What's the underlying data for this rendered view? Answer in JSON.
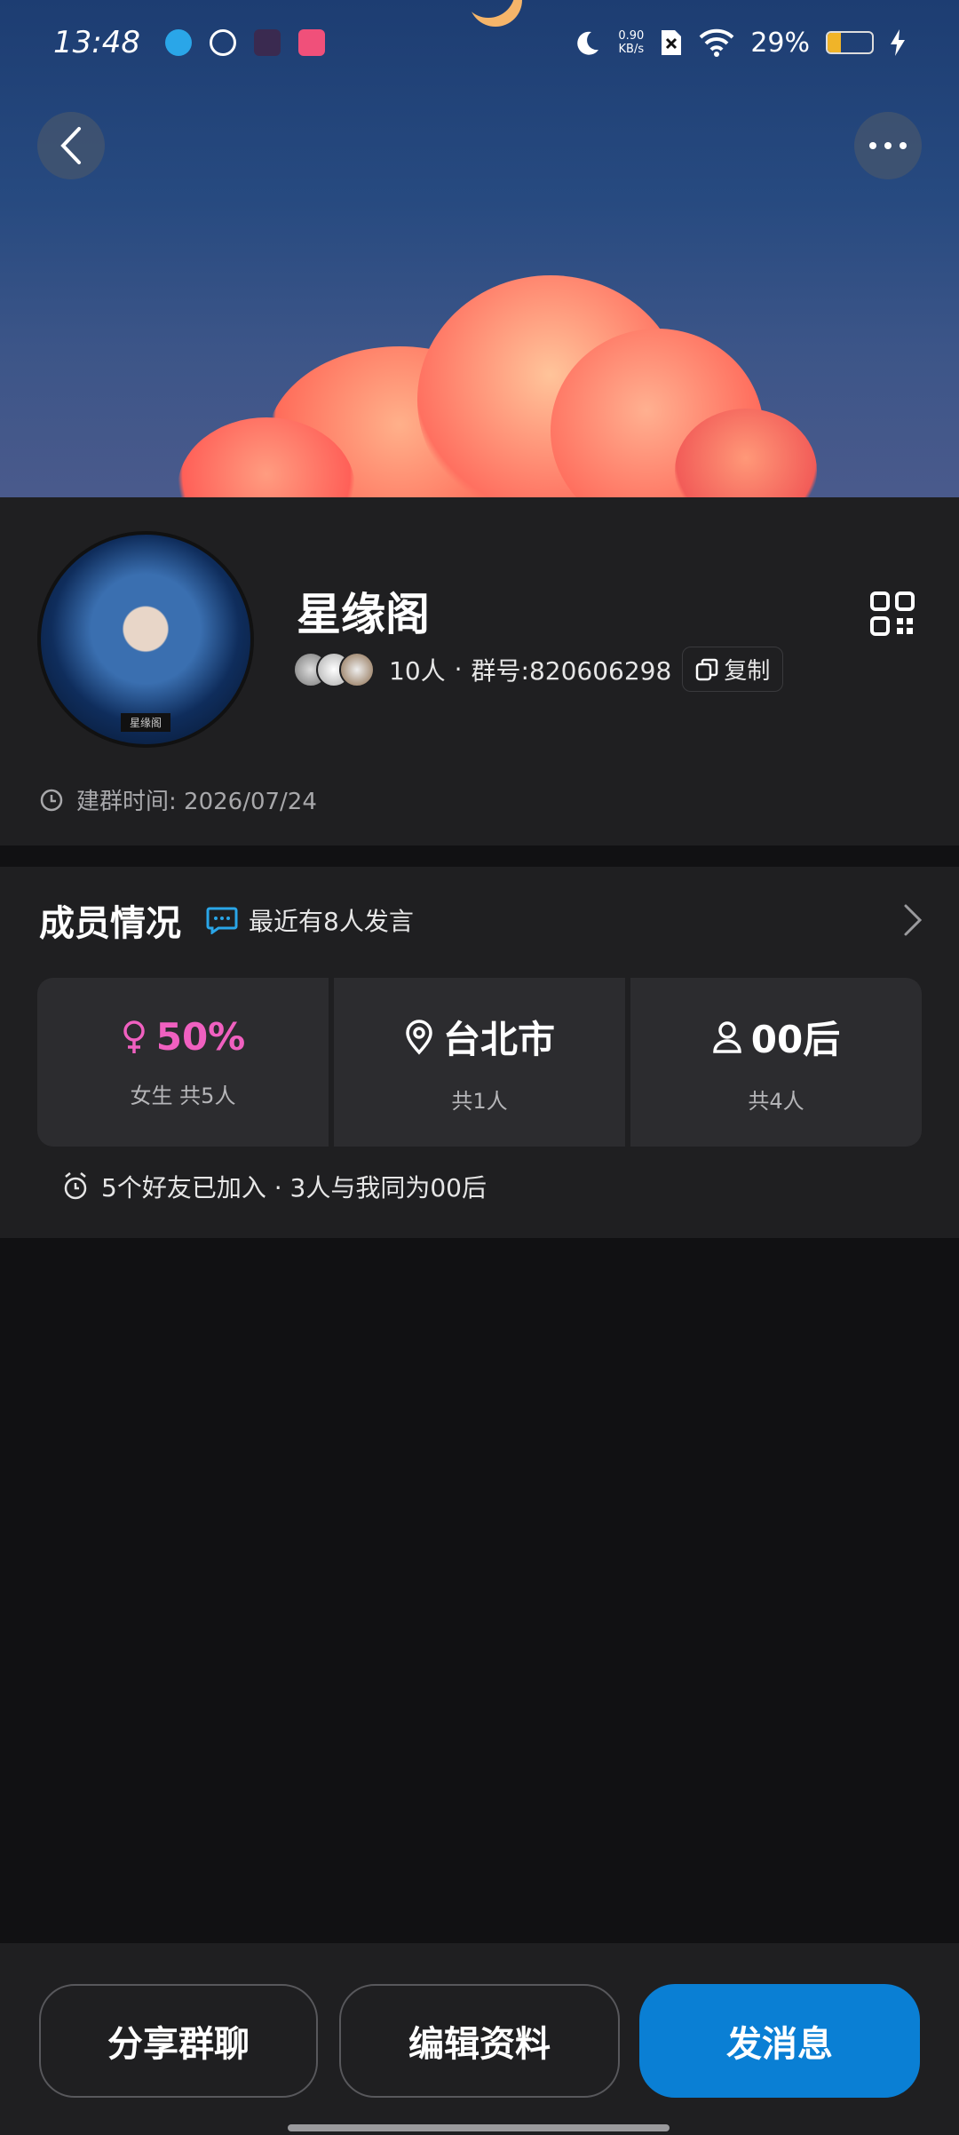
{
  "status_bar": {
    "time": "13:48",
    "net_speed_value": "0.90",
    "net_speed_unit": "KB/s",
    "battery_text": "29%",
    "battery_level": 0.29
  },
  "group": {
    "name": "星缘阁",
    "member_count": "10人",
    "separator": "·",
    "group_number": "群号:820606298",
    "copy_label": "复制",
    "created_label": "建群时间: 2026/07/24"
  },
  "members": {
    "title": "成员情况",
    "recent_speakers": "最近有8人发言",
    "stats": [
      {
        "main": "50%",
        "sub": "女生 共5人",
        "icon": "female-icon"
      },
      {
        "main": "台北市",
        "sub": "共1人",
        "icon": "location-pin-icon"
      },
      {
        "main": "00后",
        "sub": "共4人",
        "icon": "person-icon"
      }
    ],
    "friends_info": "5个好友已加入 · 3人与我同为00后"
  },
  "actions": {
    "share": "分享群聊",
    "edit": "编辑资料",
    "send": "发消息"
  },
  "colors": {
    "accent": "#0a7fd4",
    "female": "#f060c0",
    "card_bg": "#1f1f21",
    "page_bg": "#111113"
  }
}
